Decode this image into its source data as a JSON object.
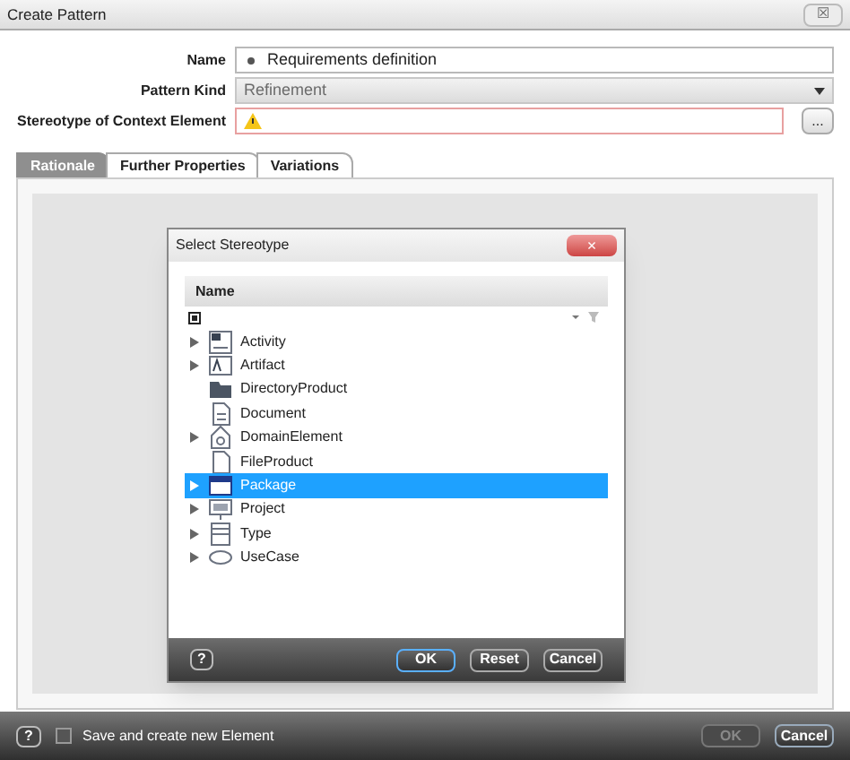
{
  "window": {
    "title": "Create Pattern",
    "close": "☒"
  },
  "form": [
    {
      "label": "Name",
      "kind": "text",
      "value": "Requirements definition",
      "required": true
    },
    {
      "label": "Pattern Kind",
      "kind": "select",
      "value": "Refinement"
    },
    {
      "label": "Stereotype of Context Element",
      "kind": "browse",
      "warning": true,
      "button": "..."
    }
  ],
  "tabs": [
    {
      "label": "Rationale",
      "selected": true
    },
    {
      "label": "Further Properties",
      "selected": false
    },
    {
      "label": "Variations",
      "selected": false
    }
  ],
  "dialog": {
    "title": "Select Stereotype",
    "column": "Name",
    "items": [
      {
        "label": "Activity",
        "expandable": true,
        "selected": false
      },
      {
        "label": "Artifact",
        "expandable": true,
        "selected": false
      },
      {
        "label": "DirectoryProduct",
        "expandable": false,
        "selected": false
      },
      {
        "label": "Document",
        "expandable": false,
        "selected": false
      },
      {
        "label": "DomainElement",
        "expandable": true,
        "selected": false
      },
      {
        "label": "FileProduct",
        "expandable": false,
        "selected": false
      },
      {
        "label": "Package",
        "expandable": true,
        "selected": true
      },
      {
        "label": "Project",
        "expandable": true,
        "selected": false
      },
      {
        "label": "Type",
        "expandable": true,
        "selected": false
      },
      {
        "label": "UseCase",
        "expandable": true,
        "selected": false
      }
    ],
    "close": "×",
    "help": "?",
    "buttons": [
      {
        "label": "OK",
        "default": true
      },
      {
        "label": "Reset",
        "default": false
      },
      {
        "label": "Cancel",
        "default": false
      }
    ]
  },
  "footer": {
    "help": "?",
    "checkbox": {
      "label": "Save and create new Element",
      "checked": false
    },
    "buttons": [
      {
        "label": "OK",
        "disabled": true
      },
      {
        "label": "Cancel",
        "disabled": false
      }
    ]
  }
}
